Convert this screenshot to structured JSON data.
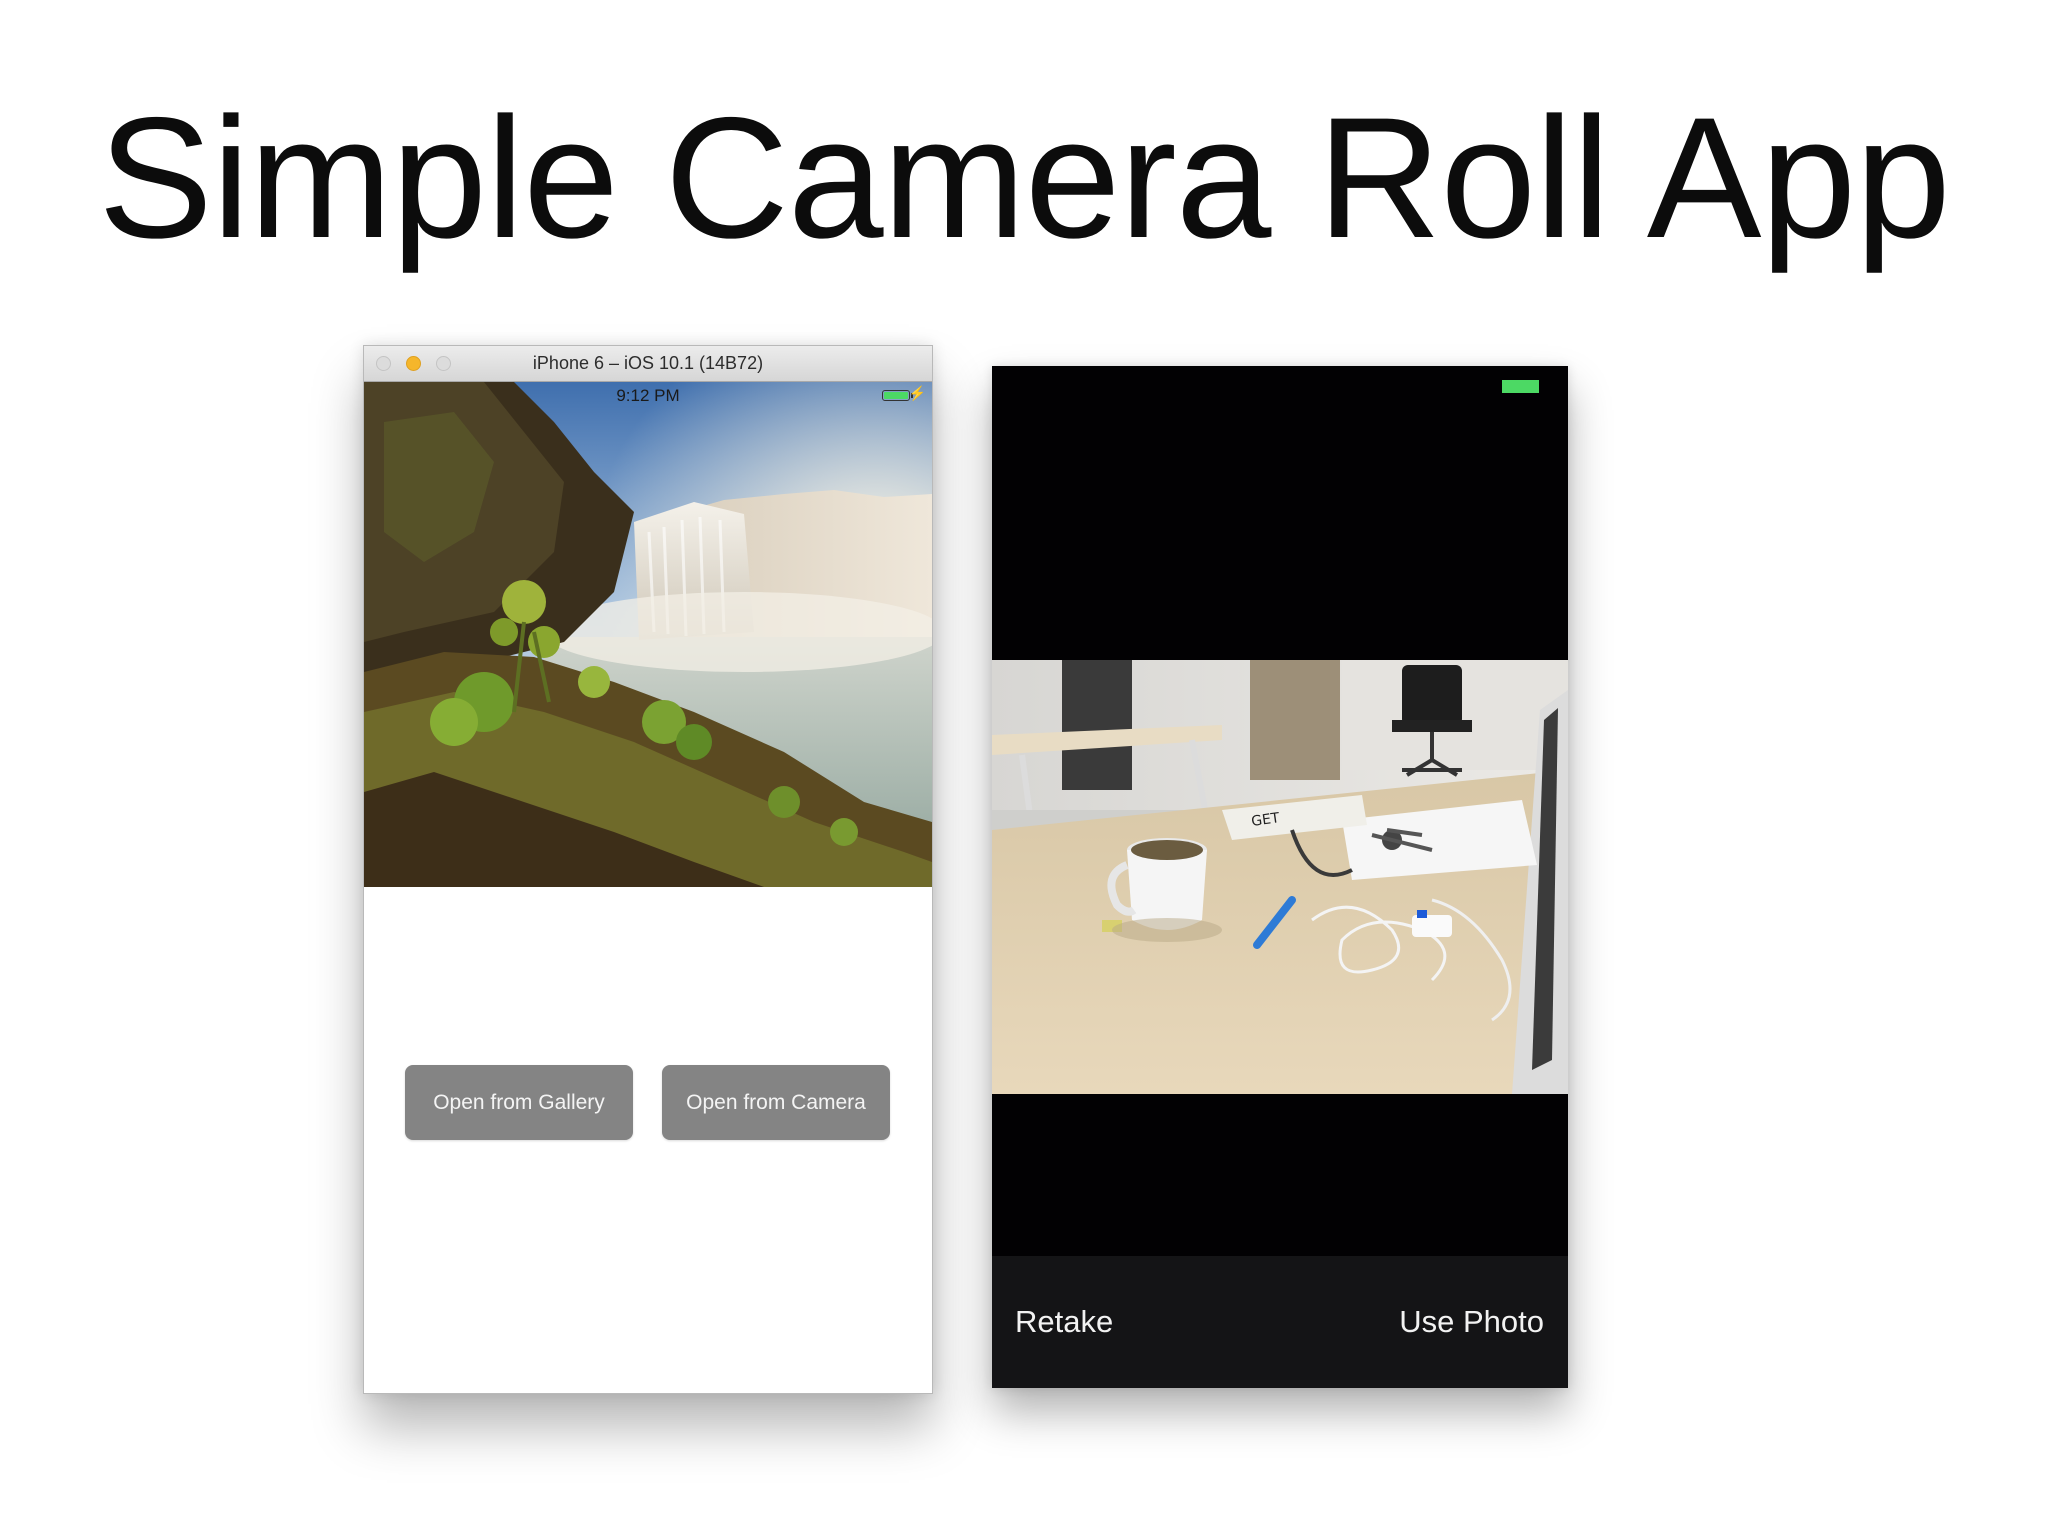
{
  "slide": {
    "title": "Simple Camera Roll App"
  },
  "simulator": {
    "window_title": "iPhone 6 – iOS 10.1 (14B72)",
    "status_time": "9:12 PM",
    "battery_level": 1.0,
    "photo_description": "waterfall-landscape",
    "buttons": {
      "gallery_label": "Open from Gallery",
      "camera_label": "Open from Camera"
    }
  },
  "camera_preview": {
    "retake_label": "Retake",
    "use_photo_label": "Use Photo",
    "photo_description": "office-desk"
  },
  "colors": {
    "button_gray": "#848484",
    "battery_green": "#4cd964",
    "camera_background": "#020103",
    "camera_toolbar": "#141416"
  }
}
